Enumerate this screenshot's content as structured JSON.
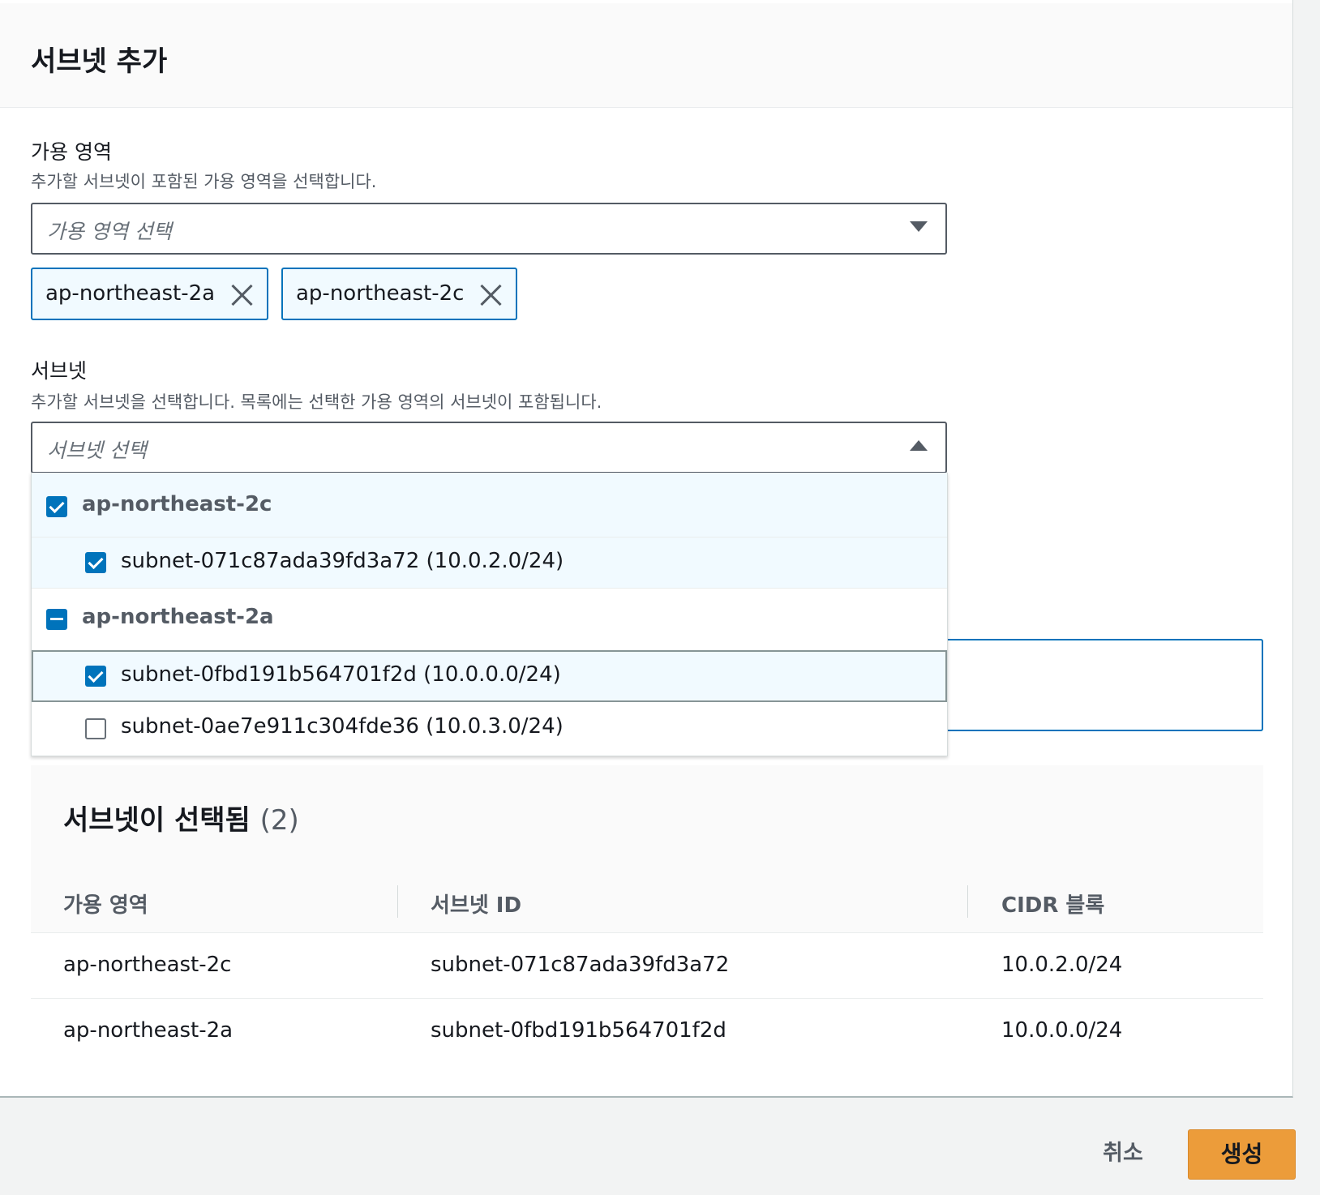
{
  "modal": {
    "title": "서브넷 추가"
  },
  "az_field": {
    "label": "가용 영역",
    "description": "추가할 서브넷이 포함된 가용 영역을 선택합니다.",
    "placeholder": "가용 영역 선택",
    "tokens": [
      "ap-northeast-2a",
      "ap-northeast-2c"
    ]
  },
  "subnet_field": {
    "label": "서브넷",
    "description": "추가할 서브넷을 선택합니다. 목록에는 선택한 가용 영역의 서브넷이 포함됩니다.",
    "placeholder": "서브넷 선택",
    "dropdown_open": true,
    "groups": [
      {
        "label": "ap-northeast-2c",
        "state": "checked",
        "options": [
          {
            "label": "subnet-071c87ada39fd3a72 (10.0.2.0/24)",
            "checked": true
          }
        ]
      },
      {
        "label": "ap-northeast-2a",
        "state": "indeterminate",
        "options": [
          {
            "label": "subnet-0fbd191b564701f2d (10.0.0.0/24)",
            "checked": true,
            "focused": true
          },
          {
            "label": "subnet-0ae7e911c304fde36 (10.0.3.0/24)",
            "checked": false
          }
        ]
      }
    ]
  },
  "selected_subnets": {
    "title": "서브넷이 선택됨",
    "count": "(2)",
    "columns": [
      "가용 영역",
      "서브넷 ID",
      "CIDR 블록"
    ],
    "rows": [
      [
        "ap-northeast-2c",
        "subnet-071c87ada39fd3a72",
        "10.0.2.0/24"
      ],
      [
        "ap-northeast-2a",
        "subnet-0fbd191b564701f2d",
        "10.0.0.0/24"
      ]
    ]
  },
  "footer": {
    "cancel_label": "취소",
    "create_label": "생성"
  },
  "colors": {
    "accent": "#0073bb",
    "primary_button": "#ec9c3a",
    "token_bg": "#f1faff"
  }
}
